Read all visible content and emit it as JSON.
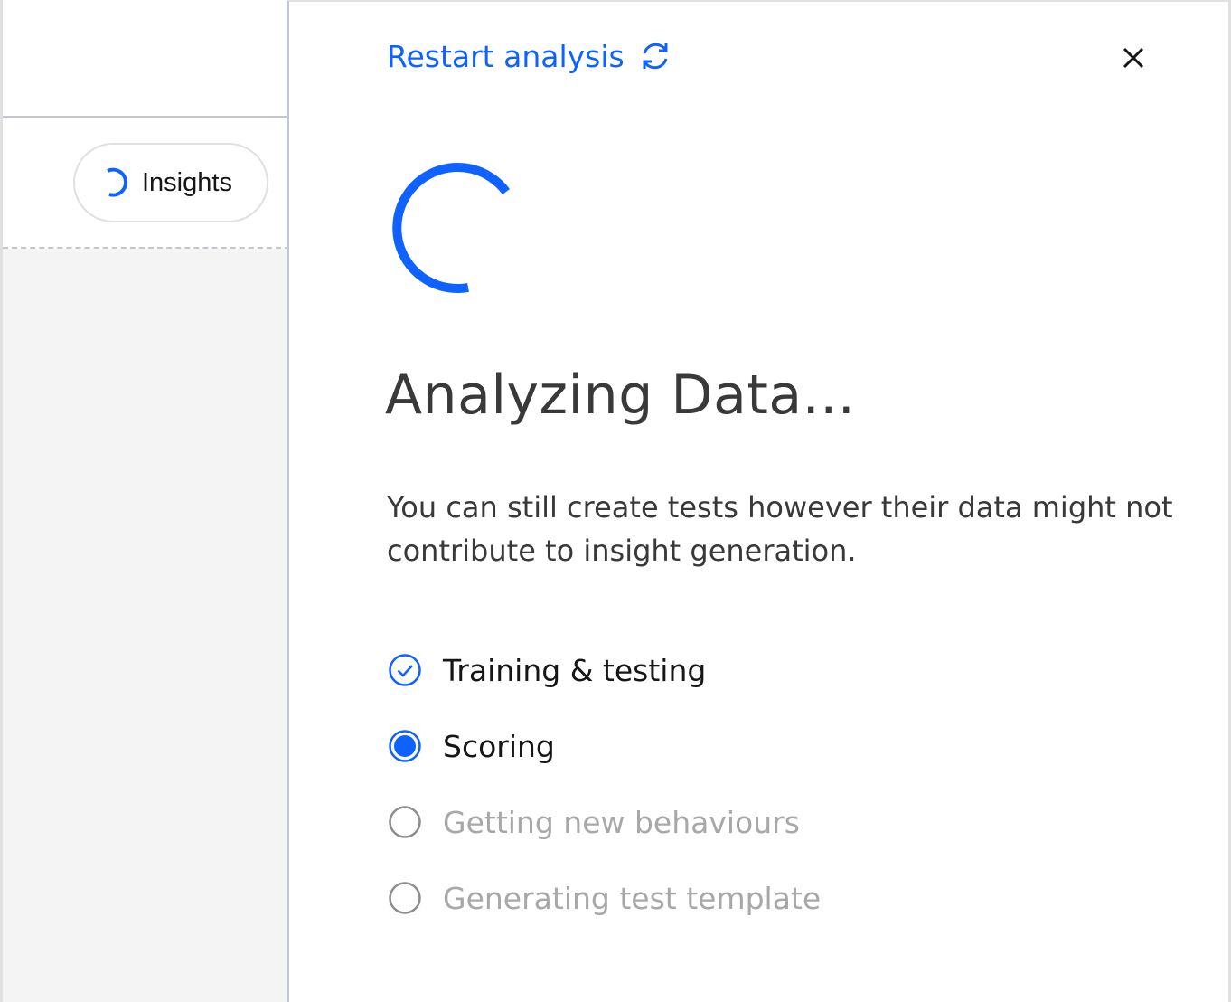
{
  "left": {
    "insights_button": {
      "label": "Insights",
      "icon": "loading-spinner-icon"
    }
  },
  "panel": {
    "restart": {
      "label": "Restart analysis",
      "icon": "restart-icon"
    },
    "close_icon": "close-icon",
    "spinner_icon": "loading-spinner-icon",
    "title": "Analyzing Data...",
    "description": "You can still create tests however their data might not contribute to insight generation.",
    "steps": [
      {
        "label": "Training & testing",
        "status": "completed",
        "icon": "checkmark-outline-icon"
      },
      {
        "label": "Scoring",
        "status": "in-progress",
        "icon": "radio-filled-icon"
      },
      {
        "label": "Getting new behaviours",
        "status": "pending",
        "icon": "circle-outline-icon"
      },
      {
        "label": "Generating test template",
        "status": "pending",
        "icon": "circle-outline-icon"
      }
    ]
  },
  "colors": {
    "accent": "#0f62fe",
    "text_primary": "#161616",
    "text_secondary": "#393939",
    "text_disabled": "#a8a8a8",
    "pending_icon": "#8d8d8d",
    "left_background": "#f4f4f4"
  }
}
